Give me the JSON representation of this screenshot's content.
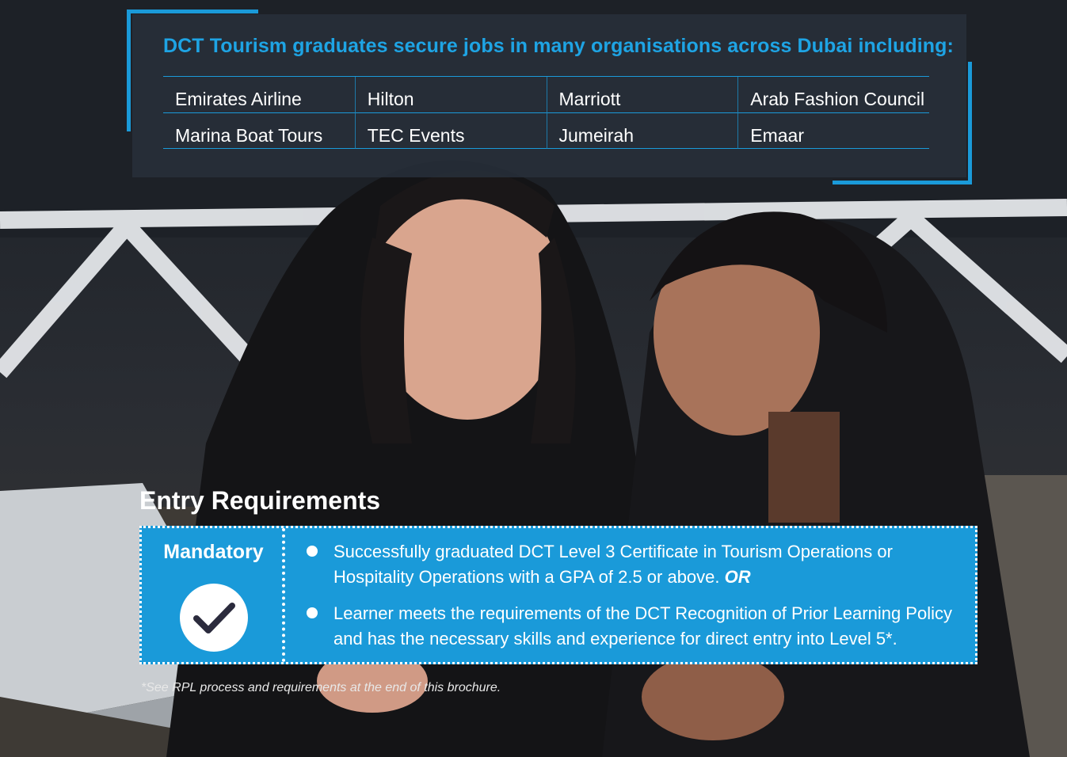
{
  "jobs": {
    "title": "DCT Tourism graduates secure jobs in many organisations across Dubai including:",
    "employers": [
      "Emirates Airline",
      "Hilton",
      "Marriott",
      "Arab Fashion Council",
      "Marina Boat Tours",
      "TEC Events",
      "Jumeirah",
      "Emaar"
    ]
  },
  "entry": {
    "heading": "Entry Requirements",
    "mandatory_label": "Mandatory",
    "check_icon": "check-circle-icon",
    "requirements": [
      {
        "text": "Successfully graduated DCT Level 3 Certificate in Tourism Operations or Hospitality Operations with a GPA of 2.5 or above.",
        "suffix": "OR"
      },
      {
        "text": "Learner meets the requirements of the DCT Recognition of Prior Learning Policy and has the necessary skills and experience for direct entry into Level 5*.",
        "suffix": ""
      }
    ],
    "footnote": "*See RPL process and requirements at the end of this brochure."
  },
  "colors": {
    "accent": "#1a9ad9",
    "title_blue": "#1ea4e4",
    "panel": "#28303a",
    "check_stroke": "#2b2b3d"
  }
}
